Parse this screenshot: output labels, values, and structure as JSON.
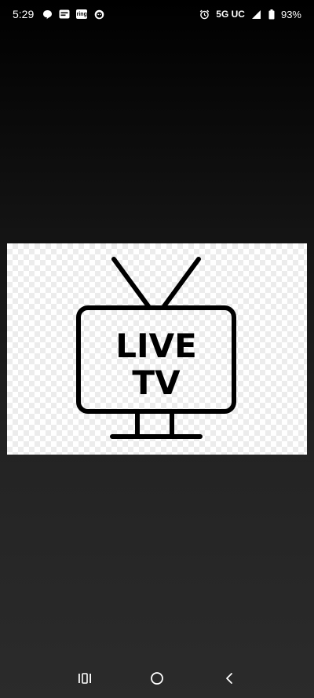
{
  "status_bar": {
    "time": "5:29",
    "network": "5G UC",
    "battery": "93%",
    "notifications": [
      "chat-bubble-icon",
      "message-card-icon",
      "ring-app-icon",
      "face-app-icon"
    ],
    "ring_label": "ring"
  },
  "image": {
    "line1": "LIVE",
    "line2": "TV"
  },
  "nav": {
    "buttons": [
      "recent-apps",
      "home",
      "back"
    ]
  },
  "colors": {
    "background_top": "#000000",
    "background_bottom": "#2b2b2b",
    "icon_stroke": "#000000",
    "card_background": "#ffffff"
  }
}
